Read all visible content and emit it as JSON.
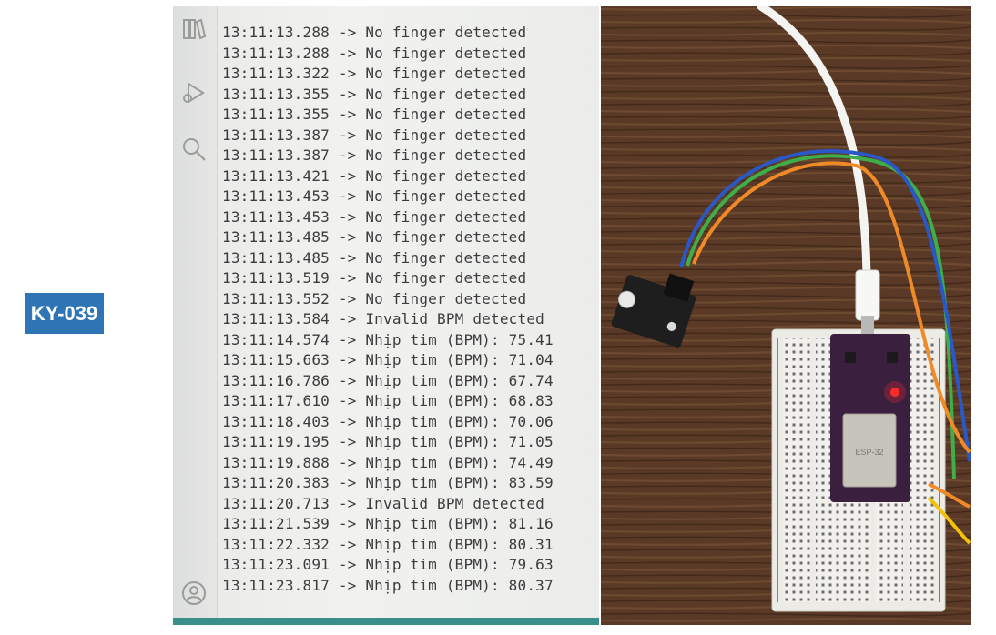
{
  "badge": {
    "text": "KY-039"
  },
  "serial_monitor": {
    "sidebar_icons": [
      "library-icon",
      "debug-icon",
      "search-icon",
      "account-icon"
    ],
    "lines": [
      {
        "time": "13:11:13.288",
        "message": "No finger detected"
      },
      {
        "time": "13:11:13.288",
        "message": "No finger detected"
      },
      {
        "time": "13:11:13.322",
        "message": "No finger detected"
      },
      {
        "time": "13:11:13.355",
        "message": "No finger detected"
      },
      {
        "time": "13:11:13.355",
        "message": "No finger detected"
      },
      {
        "time": "13:11:13.387",
        "message": "No finger detected"
      },
      {
        "time": "13:11:13.387",
        "message": "No finger detected"
      },
      {
        "time": "13:11:13.421",
        "message": "No finger detected"
      },
      {
        "time": "13:11:13.453",
        "message": "No finger detected"
      },
      {
        "time": "13:11:13.453",
        "message": "No finger detected"
      },
      {
        "time": "13:11:13.485",
        "message": "No finger detected"
      },
      {
        "time": "13:11:13.485",
        "message": "No finger detected"
      },
      {
        "time": "13:11:13.519",
        "message": "No finger detected"
      },
      {
        "time": "13:11:13.552",
        "message": "No finger detected"
      },
      {
        "time": "13:11:13.584",
        "message": "Invalid BPM detected"
      },
      {
        "time": "13:11:14.574",
        "message": "Nhịp tim (BPM): 75.41"
      },
      {
        "time": "13:11:15.663",
        "message": "Nhịp tim (BPM): 71.04"
      },
      {
        "time": "13:11:16.786",
        "message": "Nhịp tim (BPM): 67.74"
      },
      {
        "time": "13:11:17.610",
        "message": "Nhịp tim (BPM): 68.83"
      },
      {
        "time": "13:11:18.403",
        "message": "Nhịp tim (BPM): 70.06"
      },
      {
        "time": "13:11:19.195",
        "message": "Nhịp tim (BPM): 71.05"
      },
      {
        "time": "13:11:19.888",
        "message": "Nhịp tim (BPM): 74.49"
      },
      {
        "time": "13:11:20.383",
        "message": "Nhịp tim (BPM): 83.59"
      },
      {
        "time": "13:11:20.713",
        "message": "Invalid BPM detected"
      },
      {
        "time": "13:11:21.539",
        "message": "Nhịp tim (BPM): 81.16"
      },
      {
        "time": "13:11:22.332",
        "message": "Nhịp tim (BPM): 80.31"
      },
      {
        "time": "13:11:23.091",
        "message": "Nhịp tim (BPM): 79.63"
      },
      {
        "time": "13:11:23.817",
        "message": "Nhịp tim (BPM): 80.37"
      }
    ]
  },
  "photo": {
    "board_label": "ESP-32",
    "colors": {
      "wood": "#5a3a26",
      "board": "#3a1f3f",
      "sensor": "#1e1e1e",
      "led": "#ff2a2a",
      "wire_green": "#3fae4a",
      "wire_orange": "#f08a28",
      "wire_blue": "#2a58c8",
      "wire_yellow": "#f2c20a",
      "usb_cable": "#f4f4f2"
    }
  }
}
